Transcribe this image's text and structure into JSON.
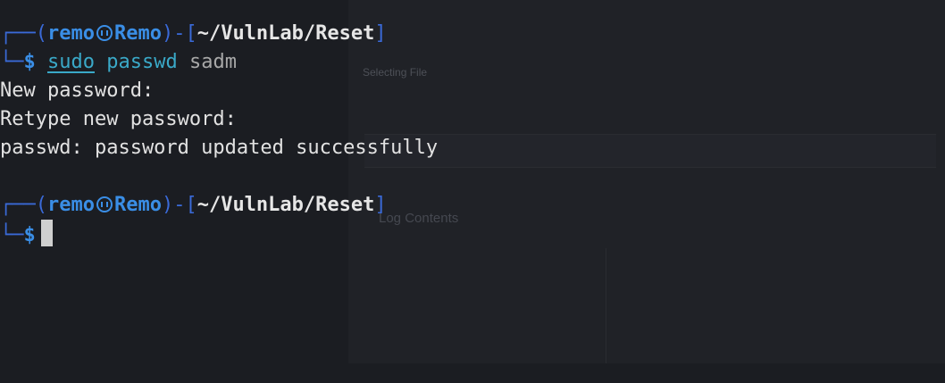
{
  "prompt": {
    "open_bracket": "┌──(",
    "user": "remo",
    "host": "Remo",
    "close_paren": ")-[",
    "path": "~/VulnLab/Reset",
    "close_bracket": "]",
    "corner": "└─",
    "dollar": "$"
  },
  "command": {
    "sudo": "sudo",
    "bin": "passwd",
    "arg": "sadm"
  },
  "output": [
    "New password:",
    "Retype new password:",
    "passwd: password updated successfully"
  ],
  "background_window": {
    "title": "",
    "section": "Selecting File",
    "field_label": "",
    "contents_header": "Log Contents",
    "log_rows": [
      [
        "",
        ""
      ],
      [
        "",
        ""
      ],
      [
        "",
        ""
      ],
      [
        "",
        ""
      ],
      [
        "",
        ""
      ],
      [
        "",
        ""
      ]
    ]
  }
}
